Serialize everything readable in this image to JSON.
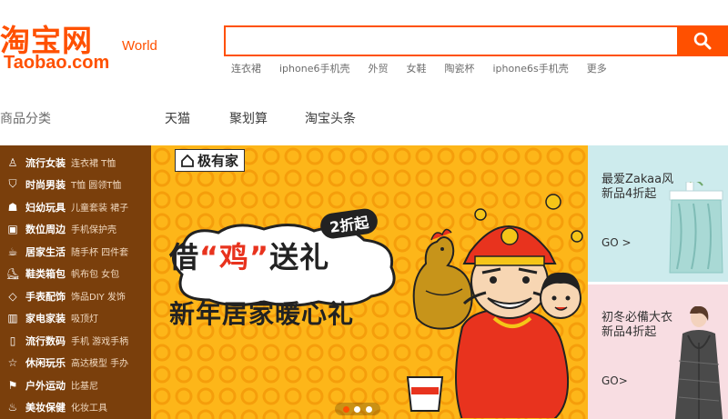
{
  "logo": {
    "cn": "淘宝网",
    "en": "Taobao.com",
    "world": "World"
  },
  "search": {
    "value": "",
    "placeholder": ""
  },
  "hot_words": [
    "连衣裙",
    "iphone6手机壳",
    "外贸",
    "女鞋",
    "陶瓷杯",
    "iphone6s手机壳",
    "更多"
  ],
  "nav": {
    "category": "商品分类",
    "items": [
      "天猫",
      "聚划算",
      "淘宝头条"
    ]
  },
  "categories": [
    {
      "icon": "person-icon",
      "main": "流行女装",
      "sub": "连衣裙 T恤"
    },
    {
      "icon": "shirt-icon",
      "main": "时尚男装",
      "sub": "T恤 圆领T恤"
    },
    {
      "icon": "toy-icon",
      "main": "妇幼玩具",
      "sub": "儿童套装 裙子"
    },
    {
      "icon": "device-icon",
      "main": "数位周边",
      "sub": "手机保护壳"
    },
    {
      "icon": "cup-icon",
      "main": "居家生活",
      "sub": "随手杯 四件套"
    },
    {
      "icon": "shoe-icon",
      "main": "鞋类箱包",
      "sub": "帆布包 女包"
    },
    {
      "icon": "diamond-icon",
      "main": "手表配饰",
      "sub": "饰品DIY 发饰"
    },
    {
      "icon": "appliance-icon",
      "main": "家电家装",
      "sub": "吸顶灯"
    },
    {
      "icon": "phone-icon",
      "main": "流行数码",
      "sub": "手机 游戏手柄"
    },
    {
      "icon": "star-icon",
      "main": "休闲玩乐",
      "sub": "高达模型 手办"
    },
    {
      "icon": "running-icon",
      "main": "户外运动",
      "sub": "比基尼"
    },
    {
      "icon": "bottle-icon",
      "main": "美妆保健",
      "sub": "化妆工具"
    }
  ],
  "banner": {
    "brand": "极有家",
    "discount": "2折起",
    "headline_a": "借",
    "headline_quote": "“鸡”",
    "headline_b": "送礼",
    "subline": "新年居家暖心礼",
    "slide_count": 3,
    "active_slide": 1
  },
  "promos": [
    {
      "title_1": "最爱Zakaa风",
      "title_2": "新品4折起",
      "cta": "GO >"
    },
    {
      "title_1": "初冬必備大衣",
      "title_2": "新品4折起",
      "cta": "GO>"
    }
  ],
  "colors": {
    "brand": "#ff5000",
    "sidebar": "#7a3f0c",
    "banner": "#fdb619",
    "promo1": "#cdebed",
    "promo2": "#f8dde2"
  }
}
